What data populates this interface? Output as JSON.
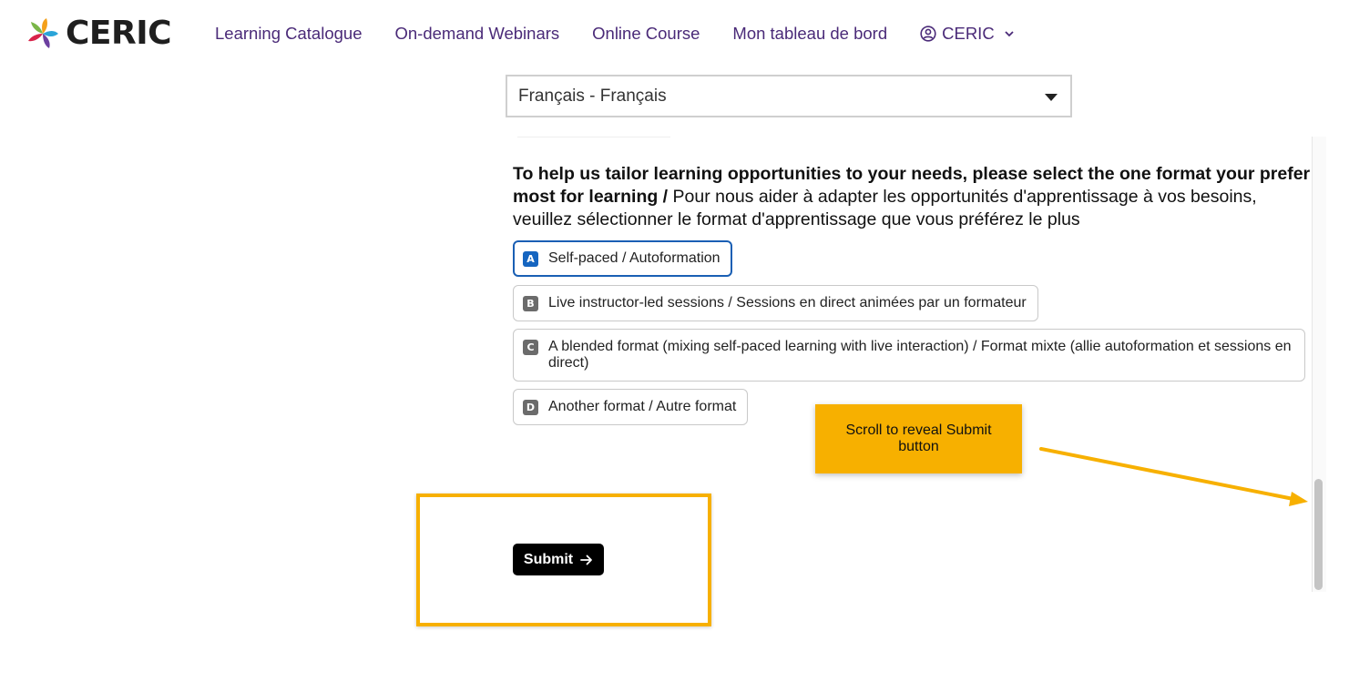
{
  "header": {
    "logo_text": "CERIC",
    "nav": [
      "Learning Catalogue",
      "On-demand Webinars",
      "Online Course",
      "Mon tableau de bord"
    ],
    "account_label": "CERIC",
    "account_icon": "user-circle-icon",
    "account_chevron_icon": "chevron-down-icon"
  },
  "language_select": {
    "value": "Français - Français"
  },
  "question": {
    "bold_text": "To help us tailor learning opportunities to your needs, please select the one format your prefer most for learning /",
    "normal_text": " Pour nous aider à adapter les opportunités d'apprentissage à vos besoins, veuillez sélectionner le format d'apprentissage que vous préférez le plus"
  },
  "options": [
    {
      "key": "A",
      "label": "Self-paced / Autoformation",
      "selected": true
    },
    {
      "key": "B",
      "label": "Live instructor-led sessions / Sessions en direct animées par un formateur",
      "selected": false
    },
    {
      "key": "C",
      "label": "A blended format (mixing self-paced learning with live interaction) / Format mixte (allie autoformation et sessions en direct)",
      "selected": false
    },
    {
      "key": "D",
      "label": "Another format / Autre format",
      "selected": false
    }
  ],
  "callout": {
    "text": "Scroll to reveal Submit button"
  },
  "submit": {
    "label": "Submit",
    "icon": "arrow-right-icon"
  },
  "colors": {
    "nav_purple": "#4a2a78",
    "callout_orange": "#f7b000",
    "selected_blue": "#1a5fb4",
    "submit_black": "#000000"
  }
}
